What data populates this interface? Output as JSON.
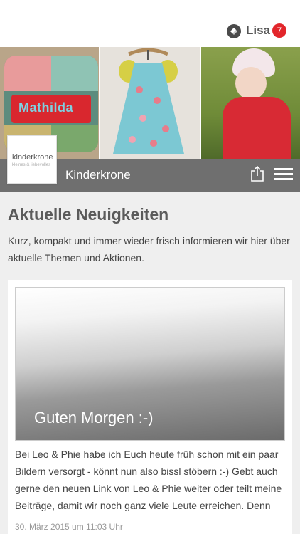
{
  "header": {
    "user_name": "Lisa",
    "notification_count": "7",
    "logo_icon": "app-logo-icon"
  },
  "hero": {
    "pillow_name": "Mathilda"
  },
  "shop": {
    "name": "Kinderkrone",
    "logo_text": "kinderkrone",
    "logo_subtext": "kleines & liebevolles"
  },
  "news": {
    "title": "Aktuelle Neuigkeiten",
    "intro": "Kurz, kompakt und immer wieder frisch informieren wir hier über aktuelle Themen und Aktionen."
  },
  "post": {
    "caption": "Guten Morgen :-)",
    "text": "Bei Leo & Phie habe ich Euch heute früh schon mit ein paar Bildern versorgt - könnt nun also bissl stöbern :-) Gebt auch gerne den neuen Link von Leo & Phie weiter oder teilt meine Beiträge, damit wir noch ganz viele Leute erreichen. Denn",
    "date": "30. März 2015 um 11:03 Uhr"
  }
}
